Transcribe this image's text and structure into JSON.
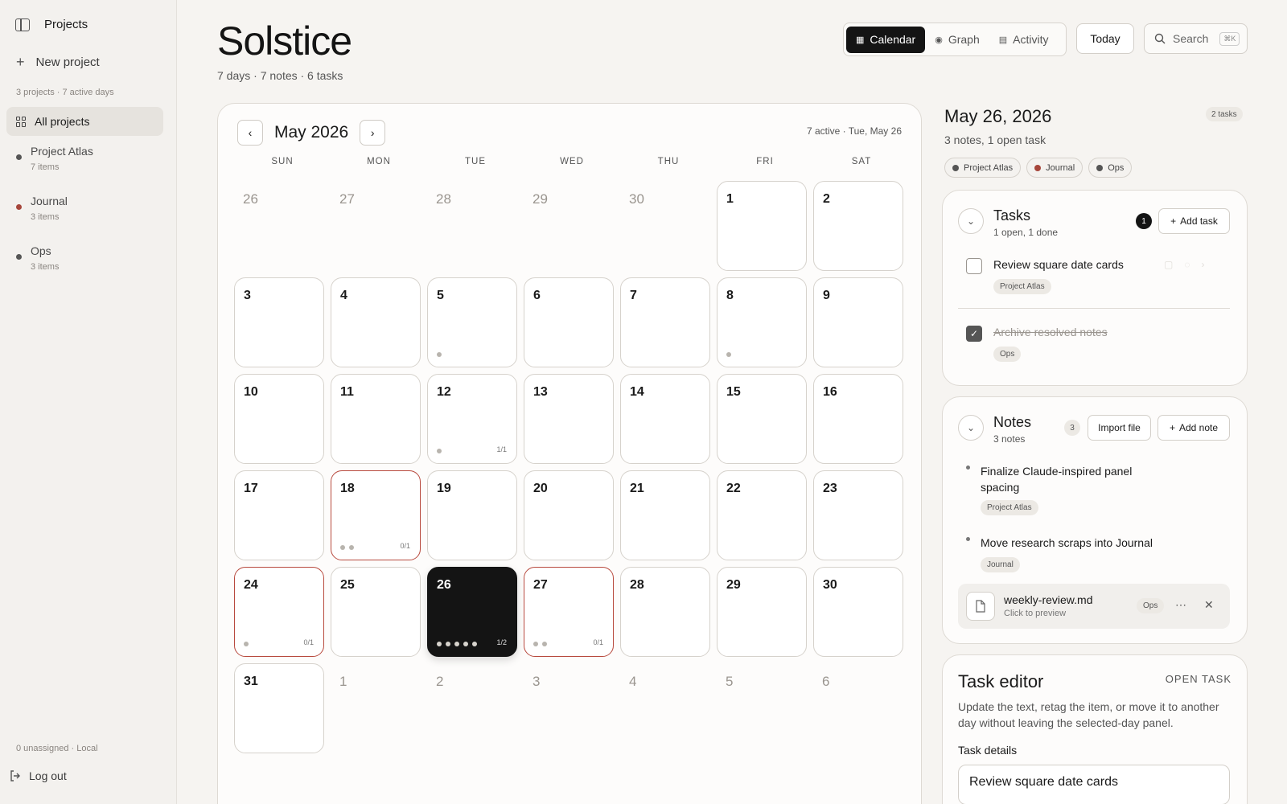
{
  "sidebar": {
    "title": "Projects",
    "new_project": "New project",
    "summary": "3 projects · 7 active days",
    "all_projects": "All projects",
    "projects": [
      {
        "name": "Project Atlas",
        "sub": "7 items",
        "color": "#555555"
      },
      {
        "name": "Journal",
        "sub": "3 items",
        "color": "#a6463b"
      },
      {
        "name": "Ops",
        "sub": "3 items",
        "color": "#555555"
      }
    ],
    "footer": "0 unassigned · Local",
    "logout": "Log out"
  },
  "header": {
    "title": "Solstice",
    "subtitle": "7 days · 7 notes · 6 tasks",
    "views": [
      {
        "label": "Calendar",
        "icon": "calendar-icon",
        "active": true
      },
      {
        "label": "Graph",
        "icon": "graph-icon",
        "active": false
      },
      {
        "label": "Activity",
        "icon": "activity-icon",
        "active": false
      }
    ],
    "today": "Today",
    "search": "Search",
    "search_kbd": "⌘K"
  },
  "calendar": {
    "month": "May 2026",
    "meta": "7 active · Tue, May 26",
    "dow": [
      "SUN",
      "MON",
      "TUE",
      "WED",
      "THU",
      "FRI",
      "SAT"
    ],
    "weeks": [
      [
        {
          "d": "26",
          "out": true
        },
        {
          "d": "27",
          "out": true
        },
        {
          "d": "28",
          "out": true
        },
        {
          "d": "29",
          "out": true
        },
        {
          "d": "30",
          "out": true
        },
        {
          "d": "1"
        },
        {
          "d": "2"
        }
      ],
      [
        {
          "d": "3"
        },
        {
          "d": "4"
        },
        {
          "d": "5",
          "dots": 1
        },
        {
          "d": "6"
        },
        {
          "d": "7"
        },
        {
          "d": "8",
          "dots": 1
        },
        {
          "d": "9"
        }
      ],
      [
        {
          "d": "10"
        },
        {
          "d": "11"
        },
        {
          "d": "12",
          "dots": 1,
          "ratio": "1/1"
        },
        {
          "d": "13"
        },
        {
          "d": "14"
        },
        {
          "d": "15"
        },
        {
          "d": "16"
        }
      ],
      [
        {
          "d": "17"
        },
        {
          "d": "18",
          "dots": 2,
          "ratio": "0/1",
          "alert": true
        },
        {
          "d": "19"
        },
        {
          "d": "20"
        },
        {
          "d": "21"
        },
        {
          "d": "22"
        },
        {
          "d": "23"
        }
      ],
      [
        {
          "d": "24",
          "dots": 1,
          "ratio": "0/1",
          "alert": true
        },
        {
          "d": "25"
        },
        {
          "d": "26",
          "dots": 5,
          "ratio": "1/2",
          "selected": true
        },
        {
          "d": "27",
          "dots": 2,
          "ratio": "0/1",
          "alert": true
        },
        {
          "d": "28"
        },
        {
          "d": "29"
        },
        {
          "d": "30"
        }
      ],
      [
        {
          "d": "31"
        },
        {
          "d": "1",
          "out": true
        },
        {
          "d": "2",
          "out": true
        },
        {
          "d": "3",
          "out": true
        },
        {
          "d": "4",
          "out": true
        },
        {
          "d": "5",
          "out": true
        },
        {
          "d": "6",
          "out": true
        }
      ]
    ]
  },
  "day_panel": {
    "date": "May 26, 2026",
    "badge": "2 tasks",
    "summary": "3 notes, 1 open task",
    "tags": [
      {
        "label": "Project Atlas",
        "color": "#555555"
      },
      {
        "label": "Journal",
        "color": "#a6463b"
      },
      {
        "label": "Ops",
        "color": "#555555"
      }
    ]
  },
  "tasks": {
    "title": "Tasks",
    "sub": "1 open, 1 done",
    "count": "1",
    "add": "Add task",
    "items": [
      {
        "text": "Review square date cards",
        "tag": "Project Atlas",
        "done": false
      },
      {
        "text": "Archive resolved notes",
        "tag": "Ops",
        "done": true
      }
    ]
  },
  "notes": {
    "title": "Notes",
    "sub": "3 notes",
    "count": "3",
    "import": "Import file",
    "add": "Add note",
    "items": [
      {
        "text": "Finalize Claude-inspired panel spacing",
        "tag": "Project Atlas"
      },
      {
        "text": "Move research scraps into Journal",
        "tag": "Journal"
      }
    ],
    "file": {
      "name": "weekly-review.md",
      "sub": "Click to preview",
      "tag": "Ops"
    }
  },
  "editor": {
    "title": "Task editor",
    "status": "OPEN TASK",
    "desc": "Update the text, retag the item, or move it to another day without leaving the selected-day panel.",
    "label": "Task details",
    "value": "Review square date cards"
  }
}
